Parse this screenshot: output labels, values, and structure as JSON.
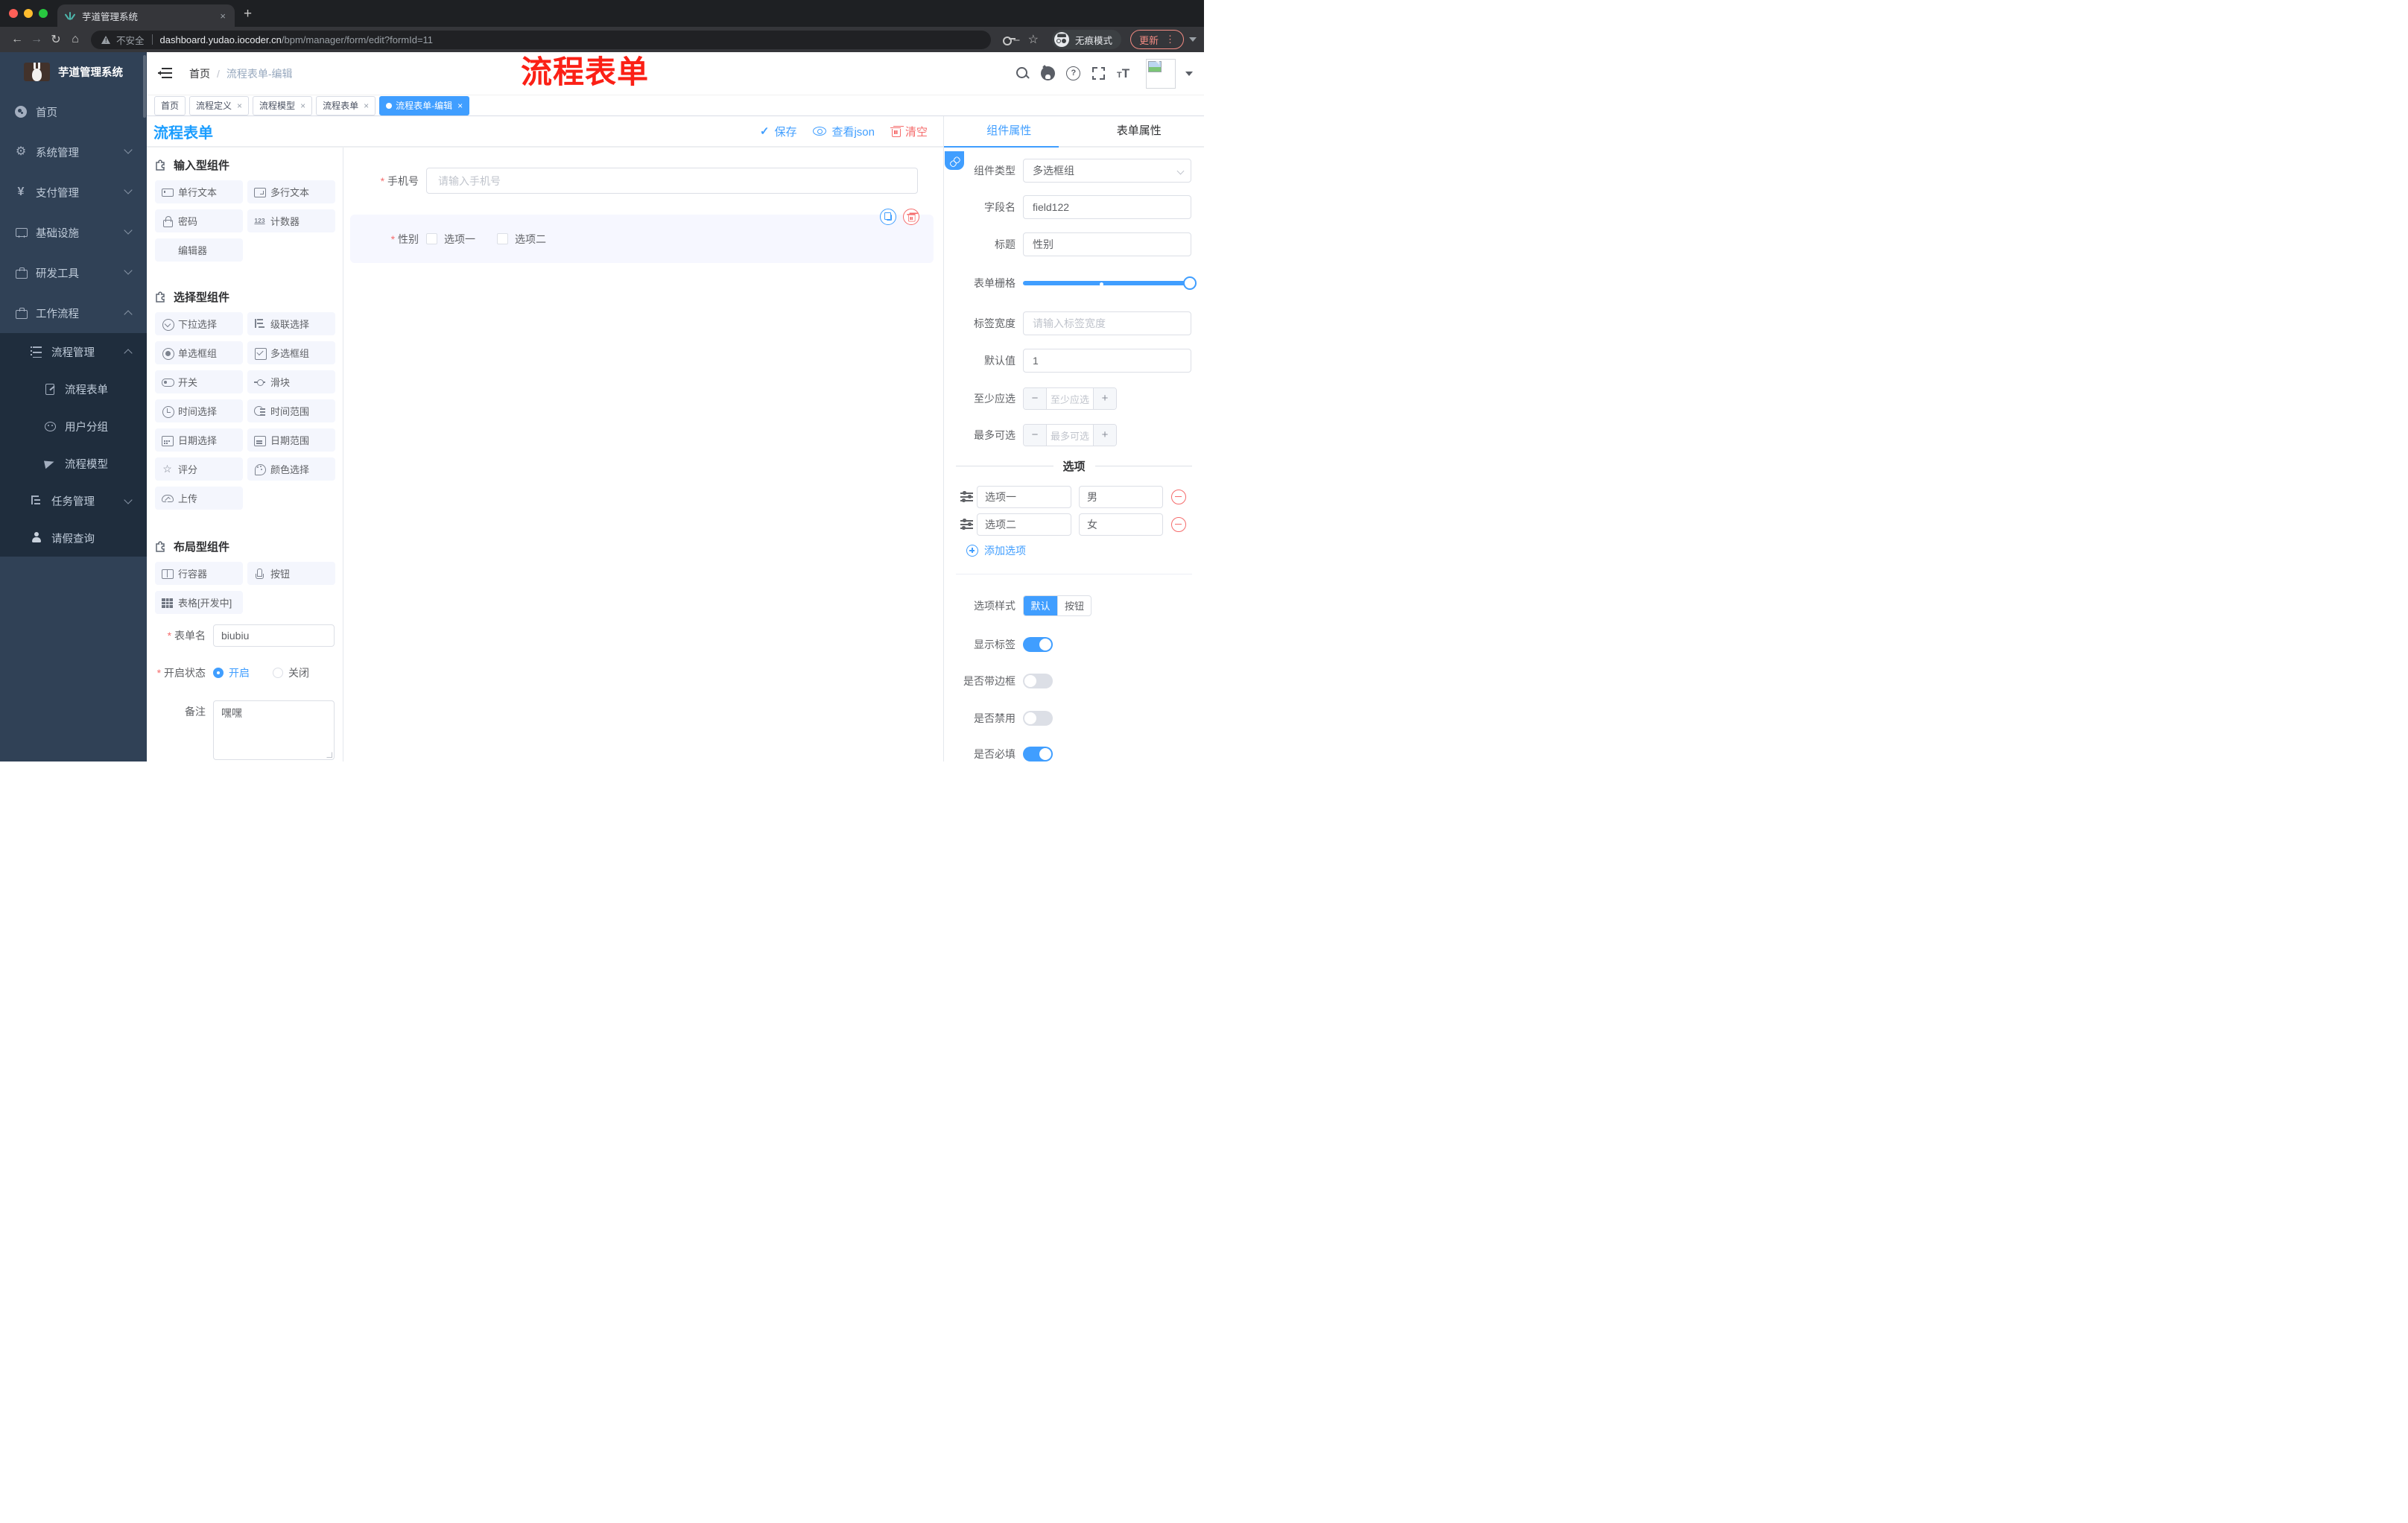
{
  "browser": {
    "tab_title": "芋道管理系统",
    "tab_close": "×",
    "new_tab": "+",
    "address": {
      "warning_label": "不安全",
      "domain": "dashboard.yudao.iocoder.cn",
      "path": "/bpm/manager/form/edit?formId=11"
    },
    "incognito_label": "无痕模式",
    "update_label": "更新",
    "menu_dots": "⋮"
  },
  "sidebar": {
    "brand": "芋道管理系统",
    "items": [
      {
        "label": "首页",
        "icon": "dashboard-icon"
      },
      {
        "label": "系统管理",
        "icon": "gear-icon"
      },
      {
        "label": "支付管理",
        "icon": "yen-icon"
      },
      {
        "label": "基础设施",
        "icon": "monitor-icon"
      },
      {
        "label": "研发工具",
        "icon": "toolbox-icon"
      },
      {
        "label": "工作流程",
        "icon": "toolbox-icon"
      }
    ],
    "submenu": [
      {
        "label": "流程管理",
        "icon": "list-icon"
      },
      {
        "label": "流程表单",
        "icon": "form-doc-icon"
      },
      {
        "label": "用户分组",
        "icon": "user-group-icon"
      },
      {
        "label": "流程模型",
        "icon": "paper-plane-icon"
      },
      {
        "label": "任务管理",
        "icon": "tree-icon"
      },
      {
        "label": "请假查询",
        "icon": "person-icon"
      }
    ]
  },
  "header": {
    "breadcrumb_home": "首页",
    "breadcrumb_sep": "/",
    "breadcrumb_current": "流程表单-编辑",
    "annotation": "流程表单",
    "annotation_color": "#fb2016"
  },
  "tags": [
    {
      "label": "首页"
    },
    {
      "label": "流程定义",
      "close": "×"
    },
    {
      "label": "流程模型",
      "close": "×"
    },
    {
      "label": "流程表单",
      "close": "×"
    },
    {
      "label": "流程表单-编辑",
      "close": "×"
    }
  ],
  "designer": {
    "title": "流程表单",
    "actions": {
      "save": "保存",
      "view_json": "查看json",
      "clear": "清空"
    },
    "components": {
      "input_group": {
        "title": "输入型组件",
        "items": [
          {
            "label": "单行文本",
            "icon": "input-box-icon"
          },
          {
            "label": "多行文本",
            "icon": "textarea-icon"
          },
          {
            "label": "密码",
            "icon": "lock-icon"
          },
          {
            "label": "计数器",
            "icon": "counter-123-icon"
          },
          {
            "label": "编辑器",
            "icon": "none"
          }
        ]
      },
      "select_group": {
        "title": "选择型组件",
        "items": [
          {
            "label": "下拉选择",
            "icon": "select-dropdown-icon"
          },
          {
            "label": "级联选择",
            "icon": "cascade-icon"
          },
          {
            "label": "单选框组",
            "icon": "radio-icon"
          },
          {
            "label": "多选框组",
            "icon": "checkbox-icon"
          },
          {
            "label": "开关",
            "icon": "switch-icon"
          },
          {
            "label": "滑块",
            "icon": "slider-icon"
          },
          {
            "label": "时间选择",
            "icon": "time-icon"
          },
          {
            "label": "时间范围",
            "icon": "time-range-icon"
          },
          {
            "label": "日期选择",
            "icon": "date-icon"
          },
          {
            "label": "日期范围",
            "icon": "date-range-icon"
          },
          {
            "label": "评分",
            "icon": "star-icon"
          },
          {
            "label": "颜色选择",
            "icon": "palette-icon"
          },
          {
            "label": "上传",
            "icon": "upload-icon"
          }
        ]
      },
      "layout_group": {
        "title": "布局型组件",
        "items": [
          {
            "label": "行容器",
            "icon": "row-container-icon"
          },
          {
            "label": "按钮",
            "icon": "hand-pointer-icon"
          },
          {
            "label": "表格[开发中]",
            "icon": "table-icon"
          }
        ]
      }
    },
    "meta_form": {
      "form_name": {
        "label": "表单名",
        "value": "biubiu"
      },
      "status": {
        "label": "开启状态",
        "on_label": "开启",
        "off_label": "关闭",
        "selected": "开启"
      },
      "remark": {
        "label": "备注",
        "value": "嘿嘿"
      }
    },
    "canvas": {
      "phone_field": {
        "label": "手机号",
        "placeholder": "请输入手机号",
        "required": true
      },
      "gender_field": {
        "label": "性别",
        "required": true,
        "option1": "选项一",
        "option2": "选项二",
        "checked": []
      }
    }
  },
  "properties": {
    "accent_color": "#409EFF",
    "tab_component": "组件属性",
    "tab_form": "表单属性",
    "component_type": {
      "label": "组件类型",
      "value": "多选框组"
    },
    "field_name": {
      "label": "字段名",
      "value": "field122"
    },
    "title_row": {
      "label": "标题",
      "value": "性别"
    },
    "grid_row": {
      "label": "表单栅格",
      "value": 24
    },
    "label_width": {
      "label": "标签宽度",
      "placeholder": "请输入标签宽度"
    },
    "default_value": {
      "label": "默认值",
      "value": "1"
    },
    "min_select": {
      "label": "至少应选",
      "placeholder": "至少应选",
      "minus": "−",
      "plus": "+"
    },
    "max_select": {
      "label": "最多可选",
      "placeholder": "最多可选",
      "minus": "−",
      "plus": "+"
    },
    "options_section": {
      "title": "选项",
      "rows": [
        {
          "label": "选项一",
          "value": "男"
        },
        {
          "label": "选项二",
          "value": "女"
        }
      ],
      "add_label": "添加选项"
    },
    "style_row": {
      "label": "选项样式",
      "on": "默认",
      "off": "按钮",
      "selected": "默认"
    },
    "switches": [
      {
        "label": "显示标签",
        "on": true
      },
      {
        "label": "是否带边框",
        "on": false
      },
      {
        "label": "是否禁用",
        "on": false
      },
      {
        "label": "是否必填",
        "on": true
      }
    ]
  }
}
